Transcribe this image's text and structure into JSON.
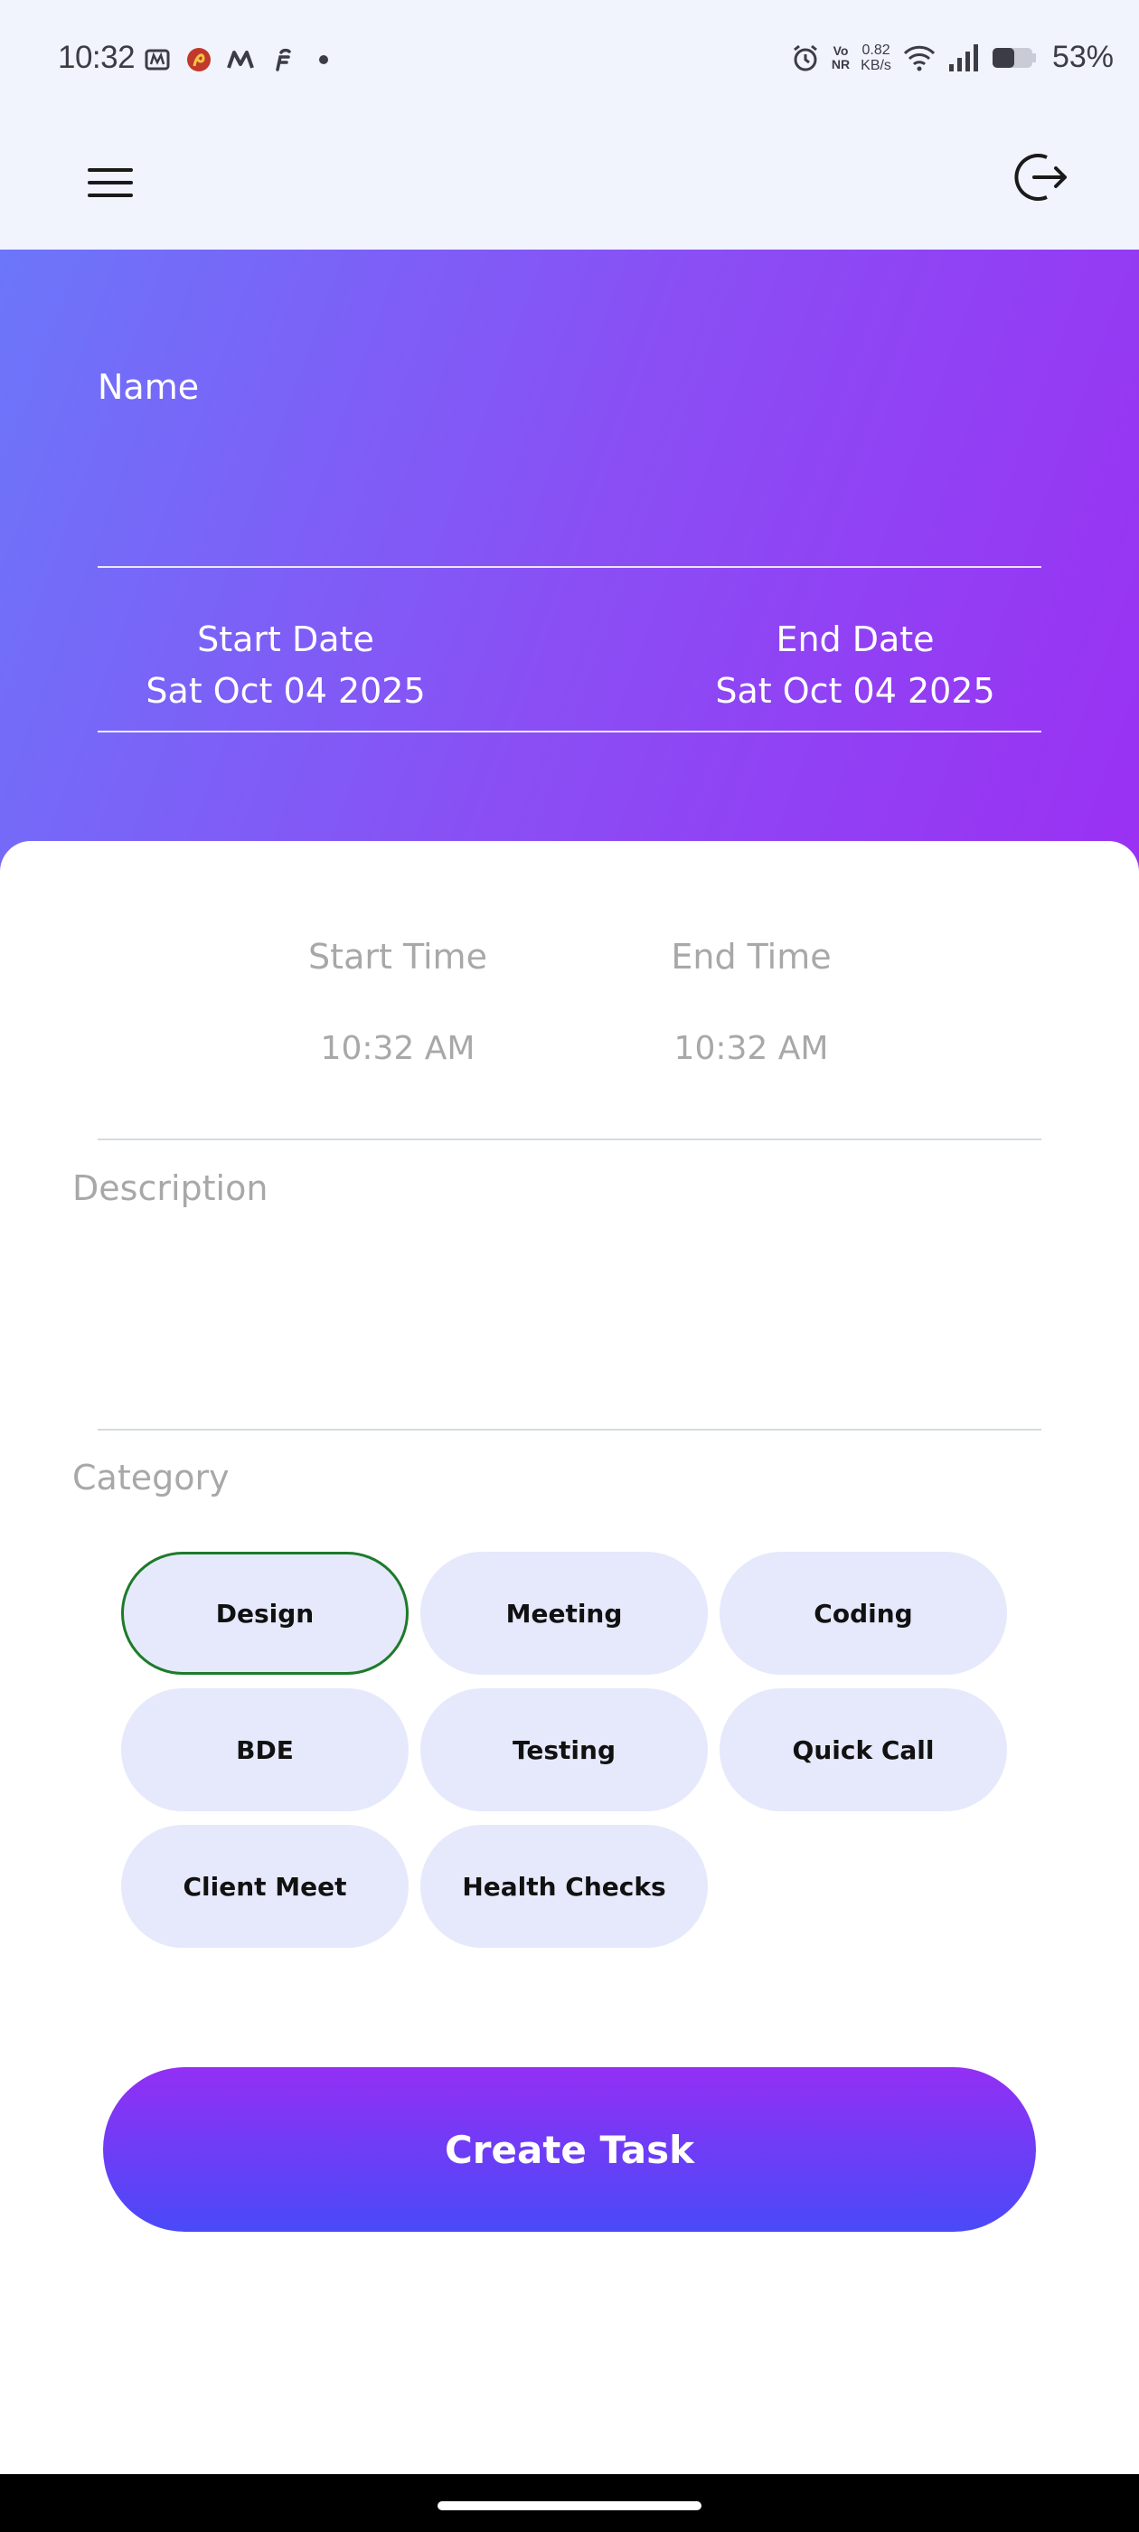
{
  "status_bar": {
    "time": "10:32",
    "notification_icons": [
      "mytra-icon",
      "airtel-icon",
      "myntra-icon",
      "flipkart-icon",
      "more-dot-icon"
    ],
    "vonr_top": "Vo",
    "vonr_bottom": "NR",
    "net_speed_value": "0.82",
    "net_speed_unit": "KB/s",
    "battery_percent": "53%"
  },
  "app_bar": {
    "menu_icon": "hamburger-menu-icon",
    "logout_icon": "logout-icon"
  },
  "form": {
    "name_label": "Name",
    "name_value": "",
    "start_date_label": "Start Date",
    "start_date_value": "Sat Oct 04 2025",
    "end_date_label": "End Date",
    "end_date_value": "Sat Oct 04 2025",
    "start_time_label": "Start Time",
    "start_time_value": "10:32 AM",
    "end_time_label": "End Time",
    "end_time_value": "10:32 AM",
    "description_label": "Description",
    "description_value": "",
    "category_label": "Category",
    "categories": [
      "Design",
      "Meeting",
      "Coding",
      "BDE",
      "Testing",
      "Quick Call",
      "Client Meet",
      "Health Checks"
    ],
    "selected_category": "Design",
    "submit_label": "Create Task"
  },
  "colors": {
    "gradient_start": "#6c76fa",
    "gradient_end": "#9a30f3",
    "chip_bg": "#e5e9fb",
    "chip_selected_border": "#1e7a2a",
    "button_top": "#932ff4",
    "button_bottom": "#4a4af8",
    "muted_text": "#a8a8a8"
  }
}
